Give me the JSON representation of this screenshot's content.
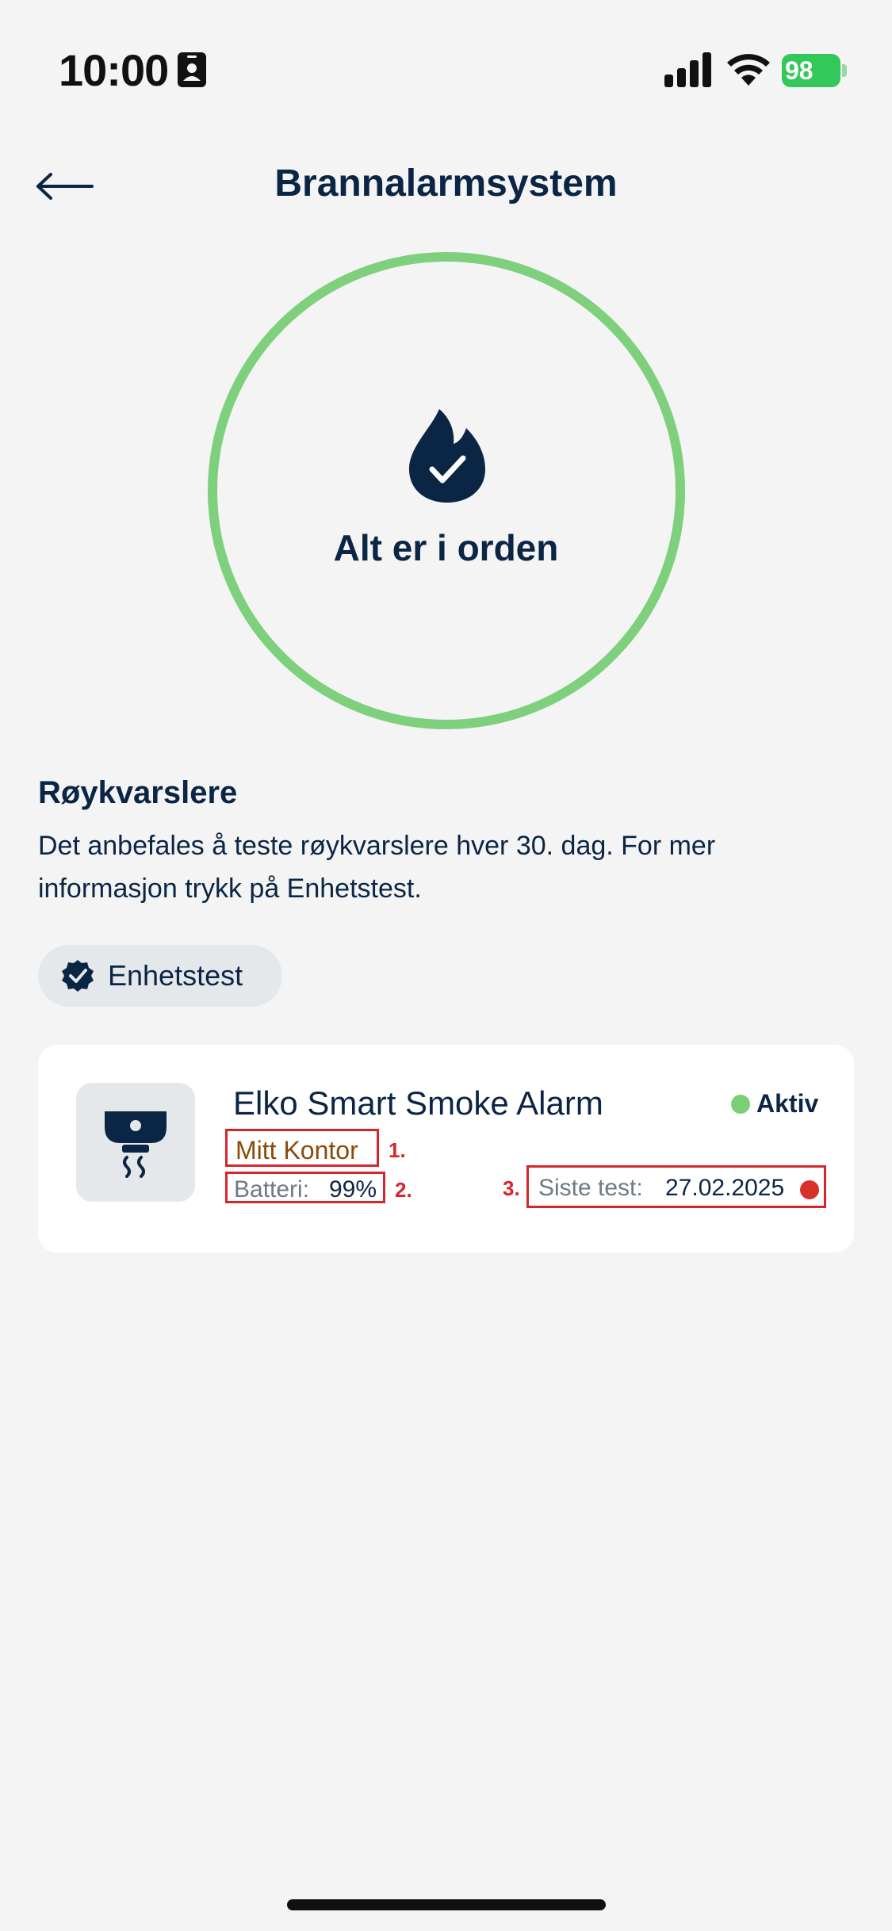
{
  "status_bar": {
    "time": "10:00",
    "battery_level": "98",
    "battery_color": "#34c759"
  },
  "header": {
    "title": "Brannalarmsystem",
    "back_icon": "arrow-left-icon"
  },
  "status_overview": {
    "icon": "flame-check-icon",
    "text": "Alt er i orden",
    "ring_color": "#7ed07c"
  },
  "section": {
    "title": "Røykvarslere",
    "description": "Det anbefales å teste røykvarslere hver 30. dag. For mer informasjon trykk på Enhetstest."
  },
  "test_button": {
    "label": "Enhetstest",
    "icon": "verified-badge-icon"
  },
  "device": {
    "icon": "smoke-detector-icon",
    "name": "Elko Smart Smoke Alarm",
    "status": "Aktiv",
    "status_color": "#78cf74",
    "location": "Mitt Kontor",
    "battery_label": "Batteri:",
    "battery_value": "99%",
    "last_test_label": "Siste test:",
    "last_test_value": "27.02.2025",
    "last_test_indicator_color": "#d9302c"
  },
  "annotations": {
    "marker_1": "1.",
    "marker_2": "2.",
    "marker_3": "3.",
    "color": "#d6262b"
  }
}
